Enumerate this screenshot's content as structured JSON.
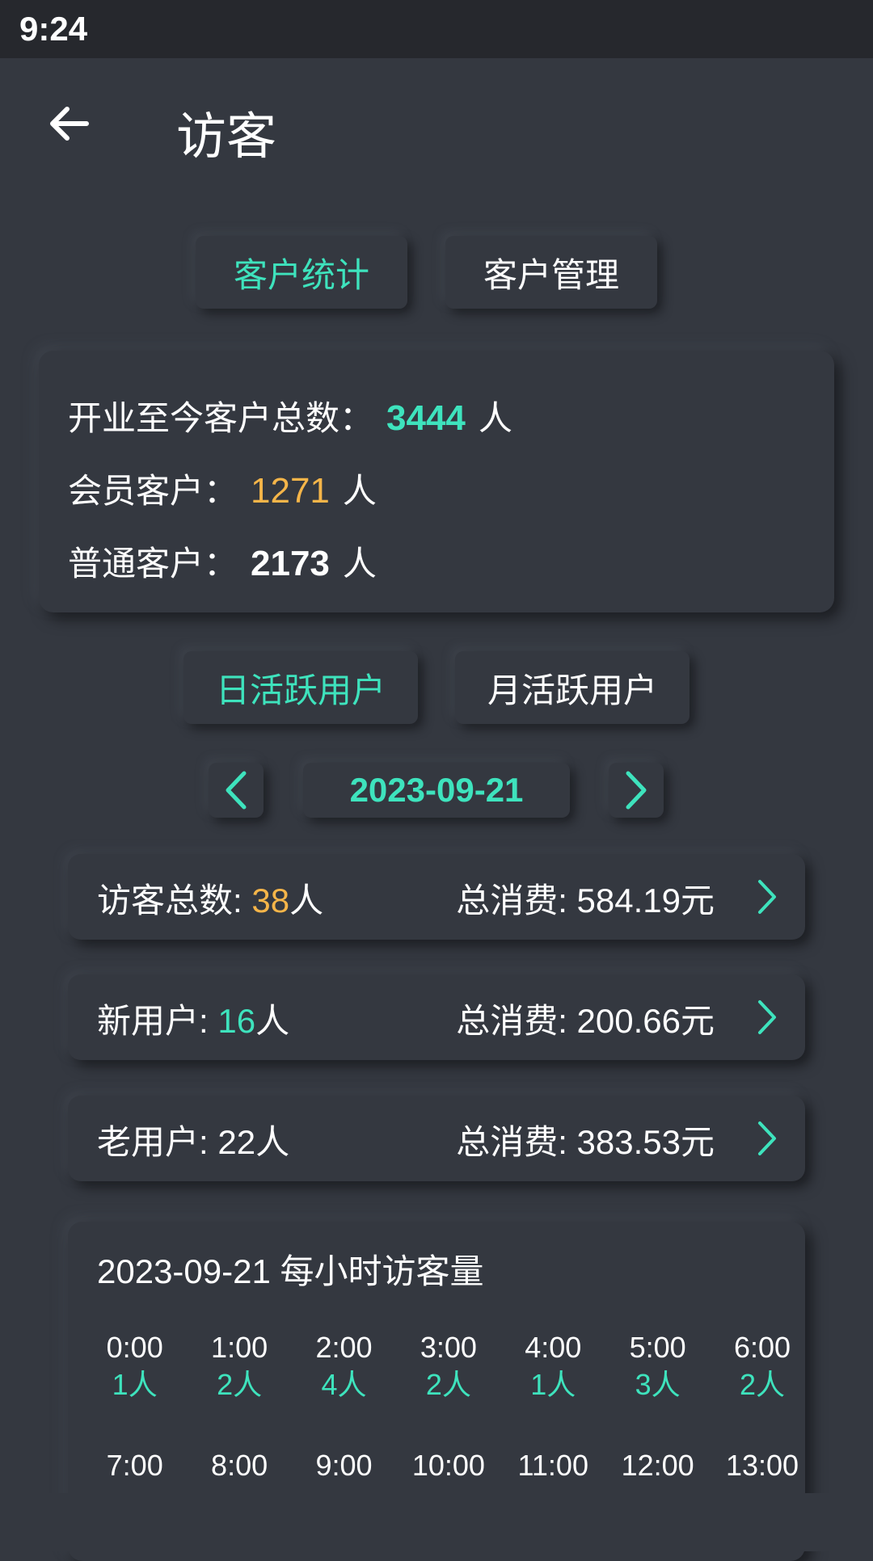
{
  "status_bar": {
    "time": "9:24"
  },
  "header": {
    "title": "访客"
  },
  "top_tabs": {
    "customer_stats": "客户统计",
    "customer_management": "客户管理"
  },
  "summary": {
    "total_label": "开业至今客户总数：",
    "total_value": "3444",
    "member_label": "会员客户：",
    "member_value": "1271",
    "regular_label": "普通客户：",
    "regular_value": "2173",
    "unit": "人"
  },
  "activity_tabs": {
    "daily": "日活跃用户",
    "monthly": "月活跃用户"
  },
  "date_picker": {
    "date": "2023-09-21"
  },
  "stats": [
    {
      "label": "访客总数: ",
      "value": "38",
      "unit": "人",
      "spend_label": "总消费:  ",
      "spend": "584.19元",
      "value_color": "orange"
    },
    {
      "label": "新用户: ",
      "value": "16",
      "unit": "人",
      "spend_label": "总消费:  ",
      "spend": "200.66元",
      "value_color": "green"
    },
    {
      "label": "老用户: ",
      "value": "22",
      "unit": "人",
      "spend_label": "总消费:  ",
      "spend": "383.53元",
      "value_color": "white"
    }
  ],
  "hourly": {
    "date": "2023-09-21",
    "title_suffix": "每小时访客量",
    "hours": [
      {
        "time": "0:00",
        "count": "1人"
      },
      {
        "time": "1:00",
        "count": "2人"
      },
      {
        "time": "2:00",
        "count": "4人"
      },
      {
        "time": "3:00",
        "count": "2人"
      },
      {
        "time": "4:00",
        "count": "1人"
      },
      {
        "time": "5:00",
        "count": "3人"
      },
      {
        "time": "6:00",
        "count": "2人"
      },
      {
        "time": "7:00",
        "count": ""
      },
      {
        "time": "8:00",
        "count": ""
      },
      {
        "time": "9:00",
        "count": ""
      },
      {
        "time": "10:00",
        "count": ""
      },
      {
        "time": "11:00",
        "count": ""
      },
      {
        "time": "12:00",
        "count": ""
      },
      {
        "time": "13:00",
        "count": ""
      }
    ]
  },
  "colors": {
    "accent_green": "#3ee3bd",
    "accent_orange": "#f5b549",
    "background": "#343840"
  }
}
